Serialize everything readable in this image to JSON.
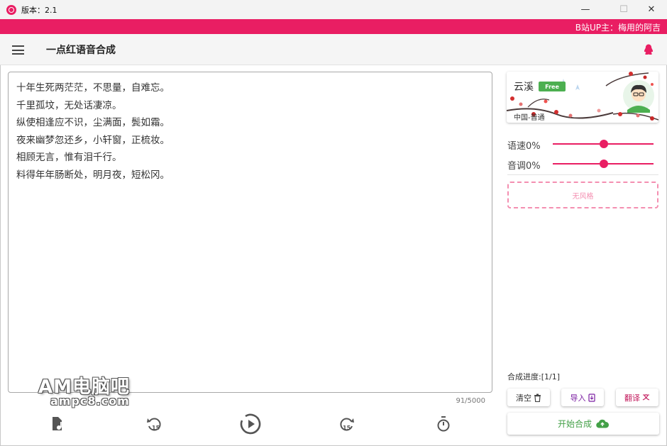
{
  "window": {
    "title": "版本：2.1",
    "controls": {
      "minimize": "—",
      "maximize": "☐",
      "close": "✕"
    }
  },
  "banner": {
    "uploader": "B站UP主：梅用的阿吉"
  },
  "appbar": {
    "title": "一点红语音合成"
  },
  "editor": {
    "lines": [
      "十年生死两茫茫，不思量，自难忘。",
      "千里孤坟，无处话凄凉。",
      "纵使相逢应不识，尘满面，鬓如霜。",
      "夜来幽梦忽还乡，小轩窗，正梳妆。",
      "相顾无言，惟有泪千行。",
      "料得年年肠断处，明月夜，短松冈。"
    ],
    "char_count": "91/5000"
  },
  "bottom_toolbar": {
    "icons": [
      "file-music-icon",
      "rewind-15-icon",
      "play-circle-icon",
      "forward-15-icon",
      "timer-icon"
    ],
    "rewind_label": "15",
    "forward_label": "15"
  },
  "watermark": {
    "line1": "AM电脑吧",
    "line2": "ampc8.com"
  },
  "voice": {
    "name": "云溪",
    "badge": "Free",
    "region": "中国-普通"
  },
  "sliders": {
    "speed": {
      "label": "语速0%",
      "value": 0
    },
    "pitch": {
      "label": "音调0%",
      "value": 0
    }
  },
  "style_button": {
    "label": "无风格"
  },
  "progress": {
    "label": "合成进度:[1/1]"
  },
  "buttons": {
    "clear": "清空",
    "import": "导入",
    "translate": "翻译",
    "start": "开始合成"
  },
  "colors": {
    "accent": "#e91e63",
    "success": "#4caf50",
    "style_dashed": "#f48fb1",
    "start_text": "#43a047"
  }
}
